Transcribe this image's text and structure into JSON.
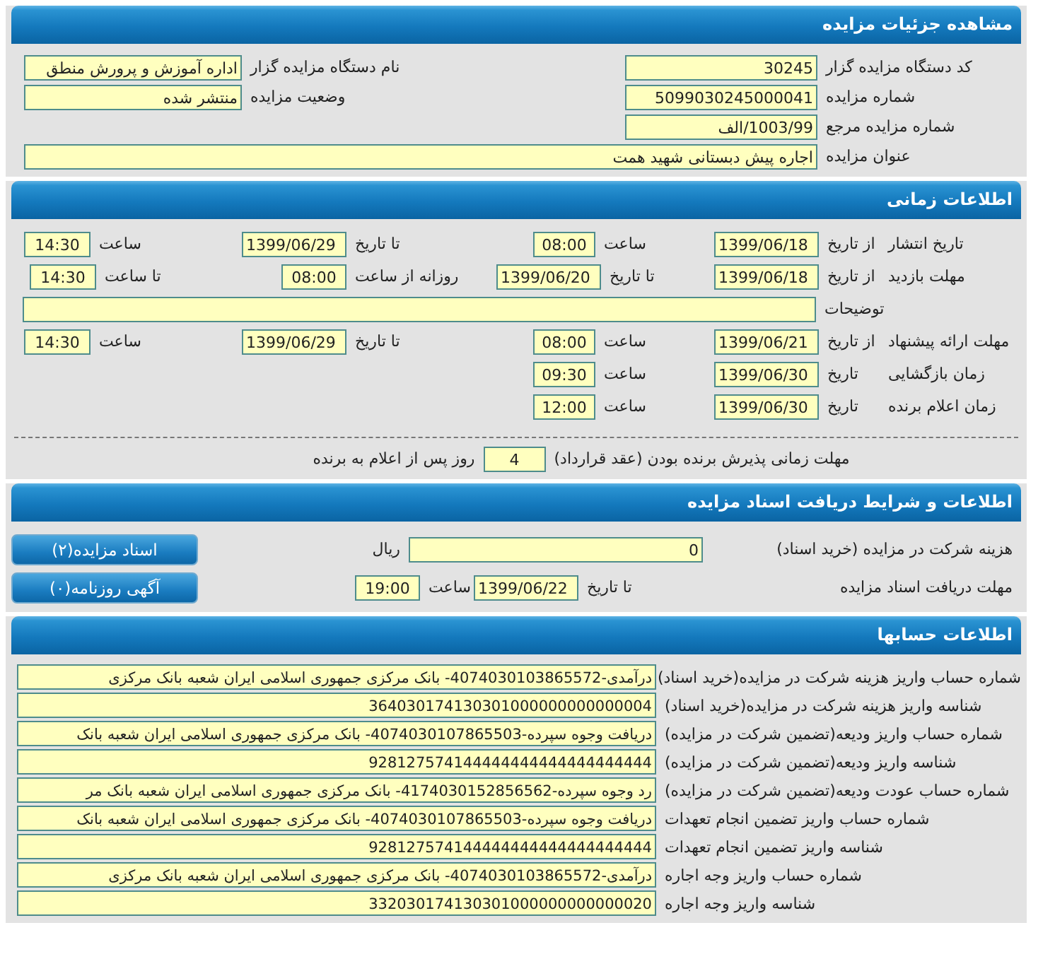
{
  "details": {
    "title": "مشاهده جزئیات مزایده",
    "rows": [
      {
        "kind": "pair",
        "fields": [
          {
            "label": "کد دستگاه مزایده گزار",
            "value": "30245"
          },
          {
            "label": "نام دستگاه مزایده گزار",
            "value": "اداره آموزش و پرورش منطق"
          }
        ]
      },
      {
        "kind": "pair",
        "fields": [
          {
            "label": "شماره مزایده",
            "value": "5099030245000041"
          },
          {
            "label": "وضعیت مزایده",
            "value": "منتشر شده"
          }
        ]
      },
      {
        "kind": "pair",
        "fields": [
          {
            "label": "شماره مزایده مرجع",
            "value": "1003/99/الف"
          }
        ]
      },
      {
        "kind": "wide",
        "fields": [
          {
            "label": "عنوان مزایده",
            "value": "اجاره پیش دبستانی شهید همت"
          }
        ]
      }
    ]
  },
  "timing": {
    "title": "اطلاعات زمانی",
    "rows": [
      {
        "kind": "range",
        "label": "تاریخ انتشار",
        "from_label": "از تاریخ",
        "from_date": "1399/06/18",
        "from_time_label": "ساعت",
        "from_time": "08:00",
        "to_label": "تا تاریخ",
        "to_date": "1399/06/29",
        "to_time_label": "ساعت",
        "to_time": "14:30"
      },
      {
        "kind": "visit",
        "label": "مهلت بازدید",
        "from_label": "از تاریخ",
        "from_date": "1399/06/18",
        "to_label": "تا تاریخ",
        "to_date": "1399/06/20",
        "daily_label": "روزانه از ساعت",
        "daily_from": "08:00",
        "daily_to_label": "تا ساعت",
        "daily_to": "14:30"
      },
      {
        "kind": "note",
        "label": "توضیحات"
      },
      {
        "kind": "range",
        "label": "مهلت ارائه پیشنهاد",
        "from_label": "از تاریخ",
        "from_date": "1399/06/21",
        "from_time_label": "ساعت",
        "from_time": "08:00",
        "to_label": "تا تاریخ",
        "to_date": "1399/06/29",
        "to_time_label": "ساعت",
        "to_time": "14:30"
      },
      {
        "kind": "single",
        "label": "زمان بازگشایی",
        "date_label": "تاریخ",
        "date": "1399/06/30",
        "time_label": "ساعت",
        "time": "09:30"
      },
      {
        "kind": "single",
        "label": "زمان اعلام برنده",
        "date_label": "تاریخ",
        "date": "1399/06/30",
        "time_label": "ساعت",
        "time": "12:00"
      }
    ],
    "acceptance": {
      "label": "مهلت زمانی پذیرش برنده بودن (عقد قرارداد)",
      "value": "4",
      "suffix": "روز پس از اعلام به برنده"
    }
  },
  "documents": {
    "title": "اطلاعات و شرایط دریافت اسناد مزایده",
    "fee": {
      "label": "هزینه شرکت در مزایده (خرید اسناد)",
      "value": "0",
      "unit": "ریال"
    },
    "deadline": {
      "label": "مهلت دریافت اسناد مزایده",
      "date_label": "تا تاریخ",
      "date": "1399/06/22",
      "time_label": "ساعت",
      "time": "19:00"
    },
    "buttons": [
      "اسناد مزایده(۲)",
      "آگهی روزنامه(۰)"
    ]
  },
  "accounts": {
    "title": "اطلاعات حسابها",
    "rows": [
      {
        "label": "شماره حساب واریز هزینه شرکت در مزایده(خرید اسناد)",
        "value": "درآمدی-4074030103865572- بانک مرکزی جمهوری اسلامی ایران شعبه بانک مرکزی"
      },
      {
        "label": "شناسه واریز هزینه شرکت در مزایده(خرید اسناد)",
        "value": "364030174130301000000000000004"
      },
      {
        "label": "شماره حساب واریز ودیعه(تضمین شرکت در مزایده)",
        "value": "دریافت وجوه سپرده-4074030107865503- بانک مرکزی جمهوری اسلامی ایران شعبه بانک"
      },
      {
        "label": "شناسه واریز ودیعه(تضمین شرکت در مزایده)",
        "value": "928127574144444444444444444444"
      },
      {
        "label": "شماره حساب عودت ودیعه(تضمین شرکت در مزایده)",
        "value": "رد وجوه سپرده-4174030152856562- بانک مرکزی جمهوری اسلامی ایران شعبه بانک مر"
      },
      {
        "label": "شماره حساب واریز تضمین انجام تعهدات",
        "value": "دریافت وجوه سپرده-4074030107865503- بانک مرکزی جمهوری اسلامی ایران شعبه بانک"
      },
      {
        "label": "شناسه واریز تضمین انجام تعهدات",
        "value": "928127574144444444444444444444"
      },
      {
        "label": "شماره حساب واریز وجه اجاره",
        "value": "درآمدی-4074030103865572- بانک مرکزی جمهوری اسلامی ایران شعبه بانک مرکزی"
      },
      {
        "label": "شناسه واریز وجه اجاره",
        "value": "332030174130301000000000000020"
      }
    ]
  }
}
